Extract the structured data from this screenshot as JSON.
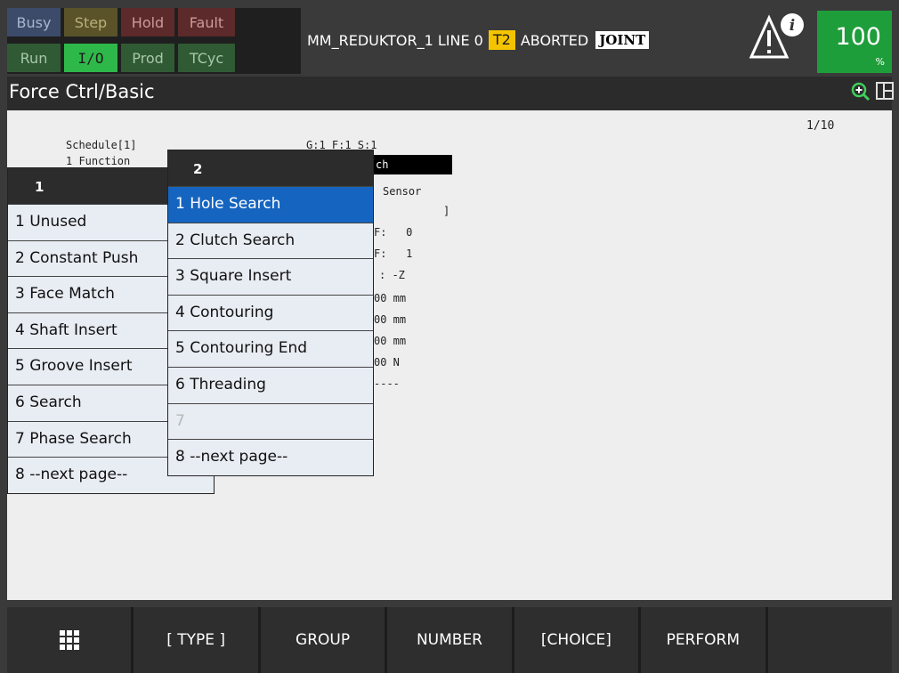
{
  "status": {
    "busy": "Busy",
    "step": "Step",
    "hold": "Hold",
    "fault": "Fault",
    "run": "Run",
    "io": "I/O",
    "prod": "Prod",
    "tcyc": "TCyc"
  },
  "program": {
    "name": "MM_REDUKTOR_1",
    "line": "LINE 0",
    "mode": "T2",
    "state": "ABORTED",
    "coord": "JOINT"
  },
  "override": {
    "value": "100",
    "unit": "%"
  },
  "screen_title": "Force Ctrl/Basic",
  "page_indicator": "1/10",
  "content_lines": {
    "schedule": "Schedule[1]",
    "gfs": "G:1 F:1 S:1",
    "function_label": "1 Function",
    "function_value": "ch",
    "sensor": "Sensor",
    "bracket": "]",
    "f0": "F:   0",
    "f1": "F:   1",
    "dir": ": -Z",
    "mm1": "00 mm",
    "mm2": "00 mm",
    "mm3": "00 mm",
    "n1": "00 N",
    "dashes": "----"
  },
  "menu1": {
    "header": "1",
    "items": [
      "1 Unused",
      "2 Constant Push",
      "3 Face Match",
      "4 Shaft Insert",
      "5 Groove Insert",
      "6 Search",
      "7 Phase Search",
      "8 --next page--"
    ]
  },
  "menu2": {
    "header": "2",
    "items": [
      "1 Hole Search",
      "2 Clutch Search",
      "3 Square Insert",
      "4 Contouring",
      "5 Contouring End",
      "6 Threading",
      "7",
      "8 --next page--"
    ],
    "selected_index": 0
  },
  "fkeys": [
    "",
    "[ TYPE ]",
    "GROUP",
    "NUMBER",
    "[CHOICE]",
    "PERFORM",
    ""
  ],
  "colors": {
    "selected": "#1565c0",
    "override_bg": "#1e9e3a",
    "io_active": "#2fb84a",
    "mode_badge": "#f5c400"
  }
}
